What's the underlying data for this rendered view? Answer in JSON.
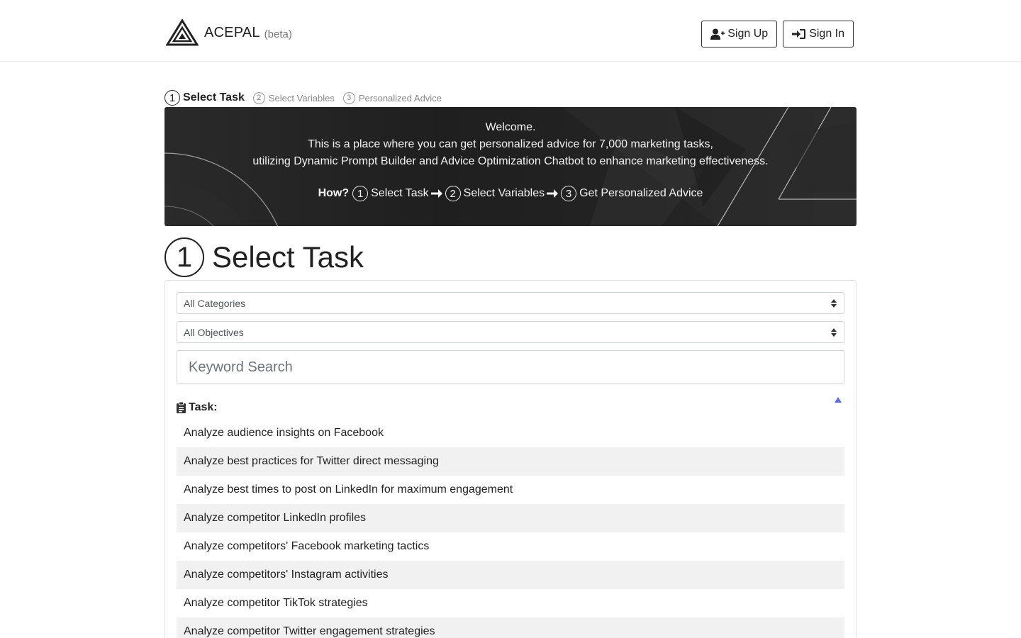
{
  "header": {
    "brand_name": "ACEPAL",
    "brand_tag": "(beta)",
    "logo_icon": "triangle-logo-icon",
    "signup_label": "Sign Up",
    "signin_label": "Sign In"
  },
  "steps": [
    {
      "num": "1",
      "label": "Select Task",
      "active": true
    },
    {
      "num": "2",
      "label": "Select Variables",
      "active": false
    },
    {
      "num": "3",
      "label": "Personalized Advice",
      "active": false
    }
  ],
  "banner": {
    "line1": "Welcome.",
    "line2": "This is a place where you can get personalized advice for 7,000 marketing tasks,",
    "line3": "utilizing Dynamic Prompt Builder and Advice Optimization Chatbot to enhance marketing effectiveness.",
    "how_label": "How?",
    "how_steps": [
      {
        "num": "1",
        "label": "Select Task"
      },
      {
        "num": "2",
        "label": "Select Variables"
      },
      {
        "num": "3",
        "label": "Get Personalized Advice"
      }
    ]
  },
  "section": {
    "num": "1",
    "title": "Select Task"
  },
  "filters": {
    "category_selected": "All Categories",
    "objective_selected": "All Objectives",
    "search_placeholder": "Keyword Search"
  },
  "task_header": {
    "label": "Task:",
    "icon": "clipboard-icon"
  },
  "tasks": [
    "Analyze audience insights on Facebook",
    "Analyze best practices for Twitter direct messaging",
    "Analyze best times to post on LinkedIn for maximum engagement",
    "Analyze competitor LinkedIn profiles",
    "Analyze competitors' Facebook marketing tactics",
    "Analyze competitors' Instagram activities",
    "Analyze competitor TikTok strategies",
    "Analyze competitor Twitter engagement strategies"
  ],
  "colors": {
    "banner_bg": "#222222",
    "accent_triangle": "#5b6fd6",
    "row_stripe": "#f1f1f1"
  }
}
